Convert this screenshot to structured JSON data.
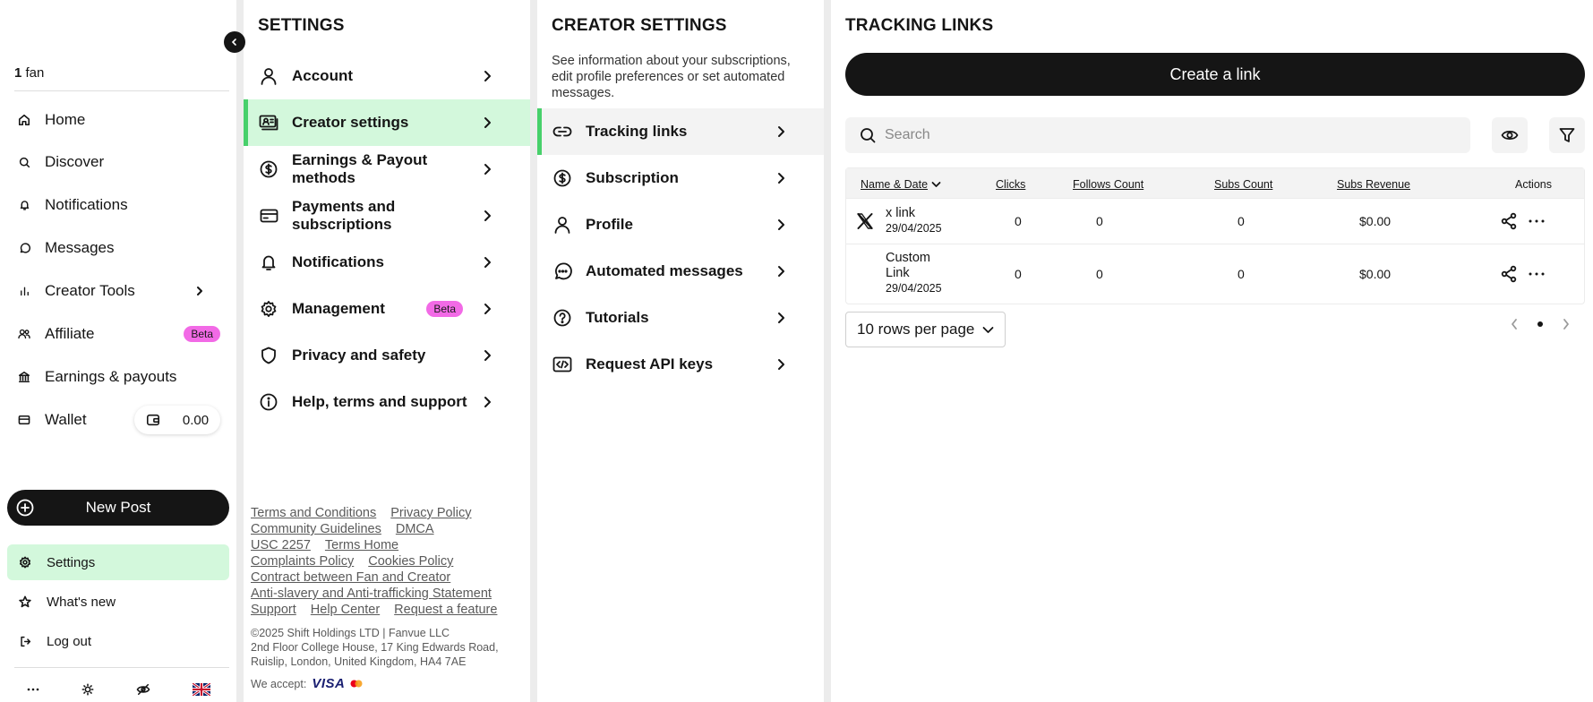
{
  "leftnav": {
    "fan_count": "1",
    "fan_label": "fan",
    "items": [
      {
        "label": "Home",
        "icon": "home-icon"
      },
      {
        "label": "Discover",
        "icon": "search-icon"
      },
      {
        "label": "Notifications",
        "icon": "bell-icon"
      },
      {
        "label": "Messages",
        "icon": "chat-bubble-icon"
      },
      {
        "label": "Creator Tools",
        "icon": "bar-chart-icon"
      },
      {
        "label": "Affiliate",
        "icon": "users-icon",
        "badge": "Beta"
      },
      {
        "label": "Earnings & payouts",
        "icon": "bank-icon"
      },
      {
        "label": "Wallet",
        "icon": "card-icon",
        "balance": "0.00"
      }
    ],
    "new_post_label": "New Post",
    "bottom": {
      "settings": "Settings",
      "whats_new": "What's new",
      "logout": "Log out"
    }
  },
  "settings": {
    "title": "SETTINGS",
    "items": [
      {
        "label": "Account",
        "icon": "user-icon"
      },
      {
        "label": "Creator settings",
        "icon": "creator-card-icon"
      },
      {
        "label": "Earnings & Payout methods",
        "icon": "dollar-circle-icon"
      },
      {
        "label": "Payments and subscriptions",
        "icon": "credit-card-icon"
      },
      {
        "label": "Notifications",
        "icon": "bell-icon"
      },
      {
        "label": "Management",
        "icon": "gear-icon",
        "badge": "Beta"
      },
      {
        "label": "Privacy and safety",
        "icon": "shield-icon"
      },
      {
        "label": "Help, terms and support",
        "icon": "info-icon"
      }
    ],
    "footer": {
      "terms": "Terms and Conditions",
      "privacy": "Privacy Policy",
      "community": "Community Guidelines",
      "dmca": "DMCA",
      "usc": "USC 2257",
      "terms_home": "Terms Home",
      "complaints": "Complaints Policy",
      "cookies": "Cookies Policy",
      "contract": "Contract between Fan and Creator",
      "antislavery": "Anti-slavery and Anti-trafficking Statement",
      "support": "Support",
      "help_center": "Help Center",
      "request_feature": "Request a feature",
      "copyright": "©2025 Shift Holdings LTD | Fanvue LLC",
      "address": "2nd Floor College House, 17 King Edwards Road, Ruislip, London, United Kingdom, HA4 7AE",
      "we_accept": "We accept:",
      "visa": "VISA"
    }
  },
  "creator": {
    "title": "CREATOR SETTINGS",
    "description": "See information about your subscriptions, edit profile preferences or set automated messages.",
    "items": [
      {
        "label": "Tracking links",
        "icon": "link-icon"
      },
      {
        "label": "Subscription",
        "icon": "dollar-circle-icon"
      },
      {
        "label": "Profile",
        "icon": "user-icon"
      },
      {
        "label": "Automated messages",
        "icon": "chat-dots-icon"
      },
      {
        "label": "Tutorials",
        "icon": "question-circle-icon"
      },
      {
        "label": "Request API keys",
        "icon": "code-icon"
      }
    ]
  },
  "tracking": {
    "title": "TRACKING LINKS",
    "create_label": "Create a link",
    "search_placeholder": "Search",
    "columns": [
      "Name & Date",
      "Clicks",
      "Follows Count",
      "Subs Count",
      "Subs Revenue",
      "Actions"
    ],
    "rows": [
      {
        "name": "x link",
        "date": "29/04/2025",
        "clicks": "0",
        "follows": "0",
        "subs": "0",
        "revenue": "$0.00",
        "icon": "x-logo-icon"
      },
      {
        "name_line1": "Custom",
        "name_line2": "Link",
        "date": "29/04/2025",
        "clicks": "0",
        "follows": "0",
        "subs": "0",
        "revenue": "$0.00"
      }
    ],
    "rows_per_page": "10 rows per page"
  }
}
